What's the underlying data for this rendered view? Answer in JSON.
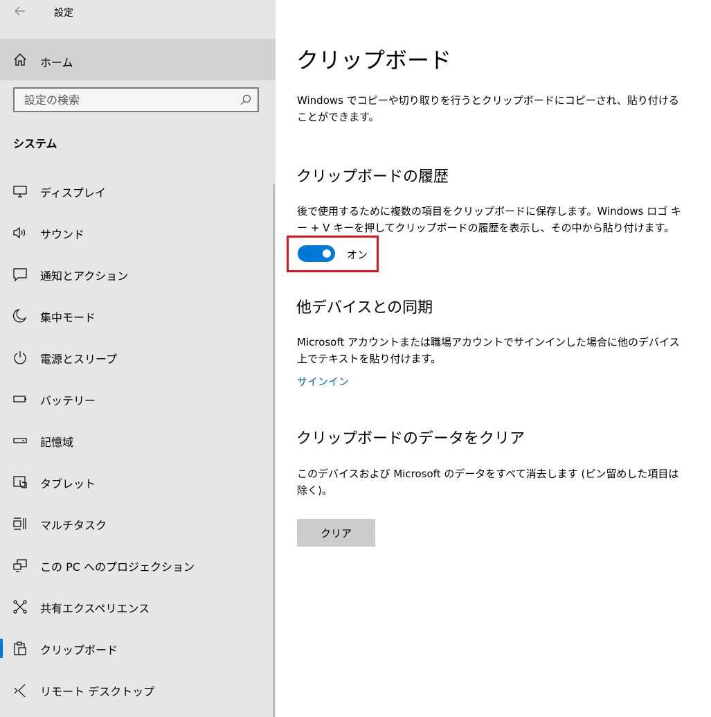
{
  "window": {
    "title": "設定"
  },
  "sidebar": {
    "home_label": "ホーム",
    "search_placeholder": "設定の検索",
    "section_header": "システム",
    "items": [
      {
        "label": "ディスプレイ",
        "icon": "display-icon"
      },
      {
        "label": "サウンド",
        "icon": "speaker-icon"
      },
      {
        "label": "通知とアクション",
        "icon": "notification-icon"
      },
      {
        "label": "集中モード",
        "icon": "moon-icon"
      },
      {
        "label": "電源とスリープ",
        "icon": "power-icon"
      },
      {
        "label": "バッテリー",
        "icon": "battery-icon"
      },
      {
        "label": "記憶域",
        "icon": "storage-icon"
      },
      {
        "label": "タブレット",
        "icon": "tablet-icon"
      },
      {
        "label": "マルチタスク",
        "icon": "multitask-icon"
      },
      {
        "label": "この PC へのプロジェクション",
        "icon": "projection-icon"
      },
      {
        "label": "共有エクスペリエンス",
        "icon": "shared-experience-icon"
      },
      {
        "label": "クリップボード",
        "icon": "clipboard-icon",
        "active": true
      },
      {
        "label": "リモート デスクトップ",
        "icon": "remote-desktop-icon"
      }
    ],
    "accent_color": "#0078d7"
  },
  "main": {
    "title": "クリップボード",
    "intro": "Windows でコピーや切り取りを行うとクリップボードにコピーされ、貼り付けることができます。",
    "history": {
      "title": "クリップボードの履歴",
      "description": "後で使用するために複数の項目をクリップボードに保存します。Windows ロゴ キー + V キーを押してクリップボードの履歴を表示し、その中から貼り付けます。",
      "toggle_state": "オン",
      "toggle_on": true,
      "highlight_color": "#e0121c"
    },
    "sync": {
      "title": "他デバイスとの同期",
      "description": "Microsoft アカウントまたは職場アカウントでサインインした場合に他のデバイス上でテキストを貼り付けます。",
      "link": "サインイン"
    },
    "clear": {
      "title": "クリップボードのデータをクリア",
      "description": "このデバイスおよび Microsoft のデータをすべて消去します (ピン留めした項目は除く)。",
      "button_label": "クリア"
    }
  }
}
